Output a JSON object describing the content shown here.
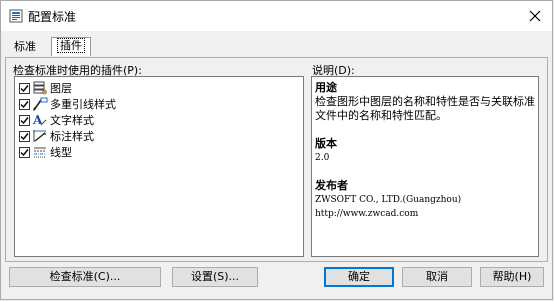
{
  "window": {
    "title": "配置标准"
  },
  "tabs": [
    {
      "label": "标准"
    },
    {
      "label": "插件"
    }
  ],
  "plugins": {
    "label": "检查标准时使用的插件(P):",
    "items": [
      {
        "label": "图层",
        "checked": true,
        "icon": "layers-icon"
      },
      {
        "label": "多重引线样式",
        "checked": true,
        "icon": "multileader-icon"
      },
      {
        "label": "文字样式",
        "checked": true,
        "icon": "text-style-icon"
      },
      {
        "label": "标注样式",
        "checked": true,
        "icon": "dimension-style-icon"
      },
      {
        "label": "线型",
        "checked": true,
        "icon": "linetype-icon"
      }
    ]
  },
  "description": {
    "label": "说明(D):",
    "purpose_heading": "用途",
    "purpose_text": "检查图形中图层的名称和特性是否与关联标准文件中的名称和特性匹配。",
    "version_heading": "版本",
    "version": "2.0",
    "publisher_heading": "发布者",
    "publisher_name": "ZWSOFT CO., LTD.(Guangzhou)",
    "publisher_url": "http://www.zwcad.com"
  },
  "buttons": {
    "check_standards": "检查标准(C)...",
    "settings": "设置(S)...",
    "ok": "确定",
    "cancel": "取消",
    "help": "帮助(H)"
  },
  "colors": {
    "accent": "#0078d7",
    "window_bg": "#f0f0f0"
  }
}
